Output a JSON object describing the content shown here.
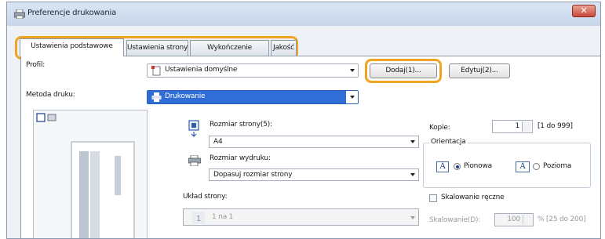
{
  "window": {
    "title": "Preferencje drukowania",
    "close_label": "✕"
  },
  "tabs": [
    {
      "label": "Ustawienia podstawowe",
      "active": true
    },
    {
      "label": "Ustawienia strony",
      "active": false
    },
    {
      "label": "Wykończenie",
      "active": false
    },
    {
      "label": "Jakość",
      "active": false
    }
  ],
  "profile": {
    "label": "Profil:",
    "value": "Ustawienia domyślne",
    "add_label": "Dodaj(1)...",
    "edit_label": "Edytuj(2)..."
  },
  "method": {
    "label": "Metoda druku:",
    "value": "Drukowanie"
  },
  "page_size": {
    "label": "Rozmiar strony(5):",
    "value": "A4"
  },
  "output_size": {
    "label": "Rozmiar wydruku:",
    "value": "Dopasuj rozmiar strony"
  },
  "layout": {
    "label": "Układ strony:",
    "value": "1 na 1"
  },
  "copies": {
    "label": "Kopie:",
    "value": "1",
    "range": "[1 do 999]"
  },
  "orientation": {
    "label": "Orientacja",
    "portrait": "Pionowa",
    "landscape": "Pozioma",
    "selected": "portrait"
  },
  "scaling": {
    "checkbox_label": "Skalowanie ręczne",
    "field_label": "Skalowanie(D):",
    "value": "100",
    "range": "% [25 do 200]"
  },
  "colors": {
    "highlight": "#f0a424",
    "selection": "#2f6ed6"
  }
}
